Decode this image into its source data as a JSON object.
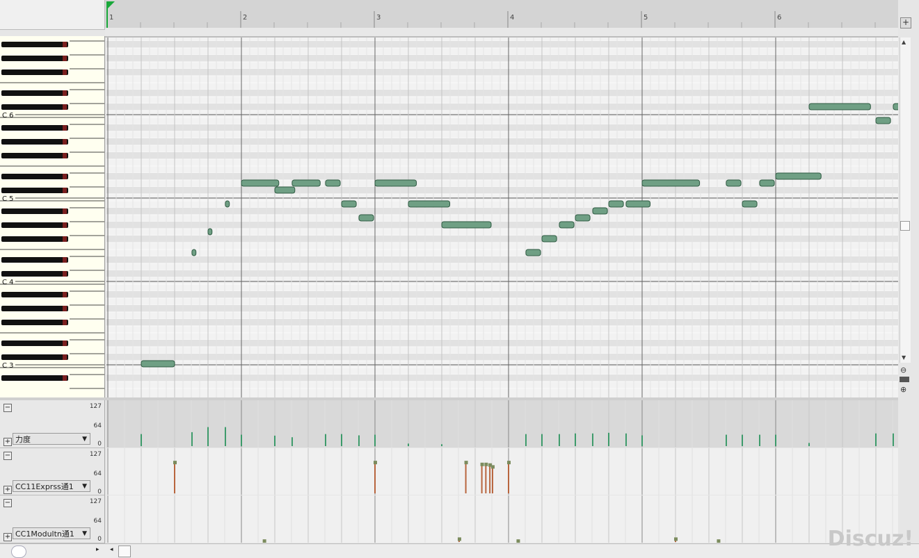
{
  "timeline": {
    "measures": [
      "1",
      "2",
      "3",
      "4",
      "5",
      "6"
    ]
  },
  "keyboard": {
    "octave_labels": [
      "C 6",
      "C 5",
      "C 4",
      "C 3"
    ]
  },
  "toolbar": {
    "add_label": "+"
  },
  "lanes": [
    {
      "name": "velocity",
      "selector": "力度",
      "max": "127",
      "mid": "64",
      "min": "0"
    },
    {
      "name": "cc11",
      "selector": "CC11Exprss通1",
      "max": "127",
      "mid": "64",
      "min": "0"
    },
    {
      "name": "cc1",
      "selector": "CC1Modultn通1",
      "max": "127",
      "mid": "64",
      "min": "0"
    }
  ],
  "notes": [
    {
      "pitch": "C3",
      "start": 1.25,
      "len": 0.25
    },
    {
      "pitch": "E4",
      "start": 1.63,
      "len": 0.03
    },
    {
      "pitch": "G4",
      "start": 1.75,
      "len": 0.03
    },
    {
      "pitch": "B4",
      "start": 1.88,
      "len": 0.03
    },
    {
      "pitch": "D5",
      "start": 2.0,
      "len": 0.28
    },
    {
      "pitch": "C#5",
      "start": 2.25,
      "len": 0.15
    },
    {
      "pitch": "D5",
      "start": 2.38,
      "len": 0.21
    },
    {
      "pitch": "D5",
      "start": 2.63,
      "len": 0.11
    },
    {
      "pitch": "B4",
      "start": 2.75,
      "len": 0.11
    },
    {
      "pitch": "A4",
      "start": 2.88,
      "len": 0.11
    },
    {
      "pitch": "D5",
      "start": 3.0,
      "len": 0.31
    },
    {
      "pitch": "B4",
      "start": 3.25,
      "len": 0.31
    },
    {
      "pitch": "G#4",
      "start": 3.5,
      "len": 0.37
    },
    {
      "pitch": "E4",
      "start": 4.13,
      "len": 0.11
    },
    {
      "pitch": "F#4",
      "start": 4.25,
      "len": 0.11
    },
    {
      "pitch": "G#4",
      "start": 4.38,
      "len": 0.11
    },
    {
      "pitch": "A4",
      "start": 4.5,
      "len": 0.11
    },
    {
      "pitch": "A#4",
      "start": 4.63,
      "len": 0.11
    },
    {
      "pitch": "B4",
      "start": 4.75,
      "len": 0.11
    },
    {
      "pitch": "B4",
      "start": 4.88,
      "len": 0.18
    },
    {
      "pitch": "D5",
      "start": 5.0,
      "len": 0.43
    },
    {
      "pitch": "D5",
      "start": 5.63,
      "len": 0.11
    },
    {
      "pitch": "B4",
      "start": 5.75,
      "len": 0.11
    },
    {
      "pitch": "D5",
      "start": 5.88,
      "len": 0.11
    },
    {
      "pitch": "D#5",
      "start": 6.0,
      "len": 0.34
    },
    {
      "pitch": "C#6",
      "start": 6.25,
      "len": 0.46
    },
    {
      "pitch": "B5",
      "start": 6.75,
      "len": 0.11
    },
    {
      "pitch": "C#6",
      "start": 6.88,
      "len": 0.05
    }
  ],
  "velocity_events": [
    {
      "beat": 1.25,
      "value": 38
    },
    {
      "beat": 1.63,
      "value": 44
    },
    {
      "beat": 1.75,
      "value": 60
    },
    {
      "beat": 1.88,
      "value": 60
    },
    {
      "beat": 2.0,
      "value": 36
    },
    {
      "beat": 2.25,
      "value": 33
    },
    {
      "beat": 2.38,
      "value": 28
    },
    {
      "beat": 2.63,
      "value": 38
    },
    {
      "beat": 2.75,
      "value": 38
    },
    {
      "beat": 2.88,
      "value": 34
    },
    {
      "beat": 3.0,
      "value": 36
    },
    {
      "beat": 3.25,
      "value": 8
    },
    {
      "beat": 3.5,
      "value": 6
    },
    {
      "beat": 4.13,
      "value": 38
    },
    {
      "beat": 4.25,
      "value": 38
    },
    {
      "beat": 4.38,
      "value": 38
    },
    {
      "beat": 4.5,
      "value": 40
    },
    {
      "beat": 4.63,
      "value": 40
    },
    {
      "beat": 4.75,
      "value": 42
    },
    {
      "beat": 4.88,
      "value": 40
    },
    {
      "beat": 5.0,
      "value": 34
    },
    {
      "beat": 5.63,
      "value": 36
    },
    {
      "beat": 5.75,
      "value": 36
    },
    {
      "beat": 5.88,
      "value": 36
    },
    {
      "beat": 6.0,
      "value": 36
    },
    {
      "beat": 6.25,
      "value": 10
    },
    {
      "beat": 6.75,
      "value": 40
    },
    {
      "beat": 6.88,
      "value": 40
    }
  ],
  "cc11_events": [
    {
      "beat": 1.5,
      "value": 100
    },
    {
      "beat": 3.0,
      "value": 100
    },
    {
      "beat": 3.68,
      "value": 100
    },
    {
      "beat": 3.8,
      "value": 94
    },
    {
      "beat": 3.83,
      "value": 94
    },
    {
      "beat": 3.86,
      "value": 92
    },
    {
      "beat": 3.88,
      "value": 86
    },
    {
      "beat": 4.0,
      "value": 100
    }
  ],
  "cc1_events": [
    {
      "beat": 2.17,
      "value": 4
    },
    {
      "beat": 3.63,
      "value": 10
    },
    {
      "beat": 4.07,
      "value": 4
    },
    {
      "beat": 5.25,
      "value": 10
    },
    {
      "beat": 5.57,
      "value": 4
    }
  ],
  "colors": {
    "note_fill": "#6f9f84",
    "note_border": "#2f5a42",
    "vel_bar": "#3c9a6a",
    "cc_bar": "#b8653e",
    "playhead": "#19a83a"
  },
  "watermark": "Discuz!"
}
